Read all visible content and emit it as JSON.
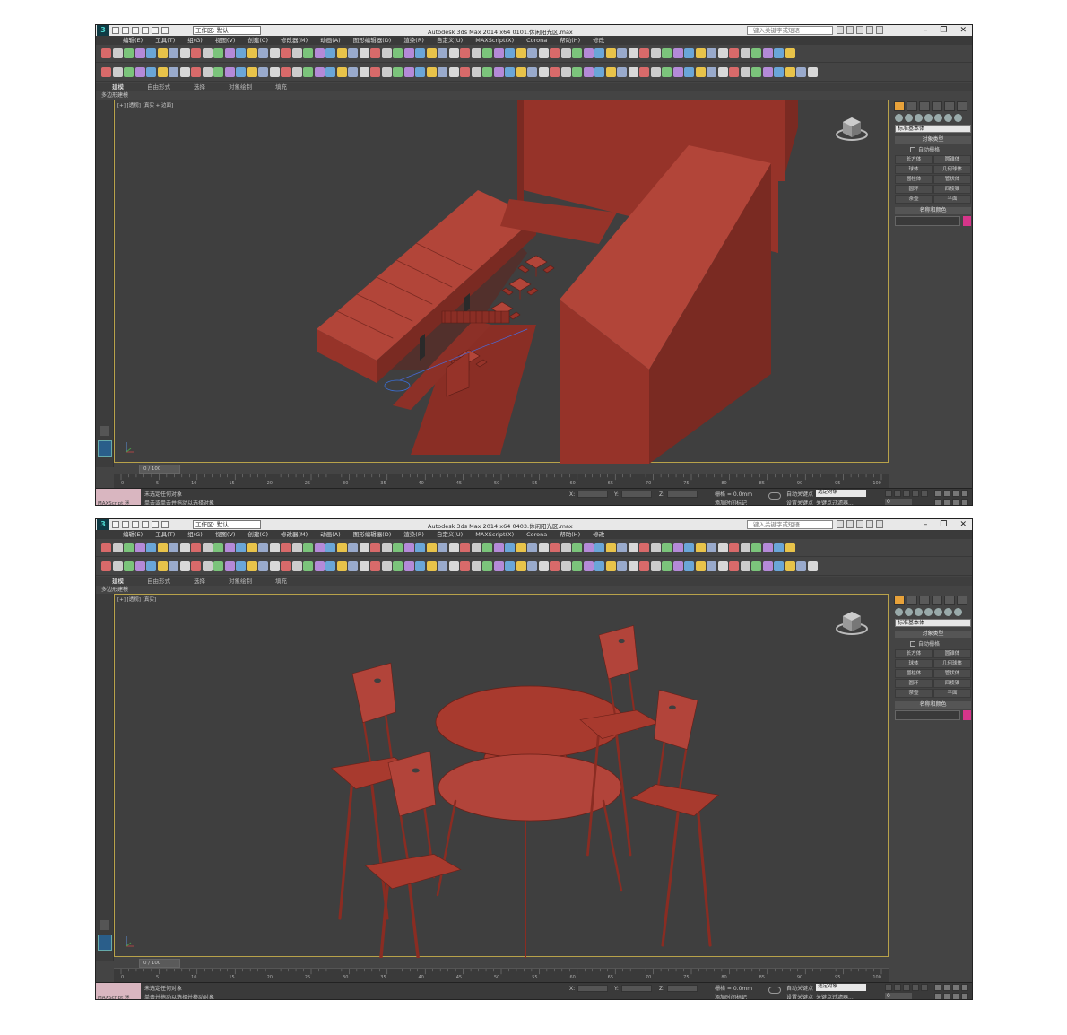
{
  "windows": [
    {
      "title": "Autodesk 3ds Max 2014 x64     0101.休闲阳光区.max",
      "workspace": "工作区: 默认",
      "search_placeholder": "键入关键字或短语",
      "menu": [
        "编辑(E)",
        "工具(T)",
        "组(G)",
        "视图(V)",
        "创建(C)",
        "修改器(M)",
        "动画(A)",
        "图形编辑器(D)",
        "渲染(R)",
        "自定义(U)",
        "MAXScript(X)",
        "Corona",
        "帮助(H)",
        "修改"
      ],
      "ribbon_tabs": [
        "建模",
        "自由形式",
        "选择",
        "对象绘制",
        "填充"
      ],
      "ribbon_sub": "多边形建模",
      "viewport_label": "[+] [透视] [真实 + 边面]",
      "cmd_dropdown": "标准基本体",
      "rollout_object_type": "对象类型",
      "autogrid": "自动栅格",
      "objects": [
        "长方体",
        "圆锥体",
        "球体",
        "几何球体",
        "圆柱体",
        "管状体",
        "圆环",
        "四棱锥",
        "茶壶",
        "平面"
      ],
      "rollout_name_color": "名称和颜色",
      "timeline_slider": "0 / 100",
      "timeline_ticks": [
        "0",
        "5",
        "10",
        "15",
        "20",
        "25",
        "30",
        "35",
        "40",
        "45",
        "50",
        "55",
        "60",
        "65",
        "70",
        "75",
        "80",
        "85",
        "90",
        "95",
        "100"
      ],
      "maxscript": "MAXScript 迷",
      "status_line1": "未选定任何对象",
      "status_line2": "单击或单击并拖动以选择对象",
      "coord_labels": [
        "X:",
        "Y:",
        "Z:"
      ],
      "grid": "栅格 = 0.0mm",
      "add_time_tag": "添加时间标记",
      "auto_key": "自动关键点",
      "set_key": "设置关键点",
      "selection_set": "选定对象",
      "key_filters": "关键点过滤器...",
      "frame": "0"
    },
    {
      "title": "Autodesk 3ds Max 2014 x64     0403.休闲阳光区.max",
      "workspace": "工作区: 默认",
      "search_placeholder": "键入关键字或短语",
      "menu": [
        "编辑(E)",
        "工具(T)",
        "组(G)",
        "视图(V)",
        "创建(C)",
        "修改器(M)",
        "动画(A)",
        "图形编辑器(D)",
        "渲染(R)",
        "自定义(U)",
        "MAXScript(X)",
        "Corona",
        "帮助(H)",
        "修改"
      ],
      "ribbon_tabs": [
        "建模",
        "自由形式",
        "选择",
        "对象绘制",
        "填充"
      ],
      "ribbon_sub": "多边形建模",
      "viewport_label": "[+] [透视] [真实]",
      "cmd_dropdown": "标准基本体",
      "rollout_object_type": "对象类型",
      "autogrid": "自动栅格",
      "objects": [
        "长方体",
        "圆锥体",
        "球体",
        "几何球体",
        "圆柱体",
        "管状体",
        "圆环",
        "四棱锥",
        "茶壶",
        "平面"
      ],
      "rollout_name_color": "名称和颜色",
      "timeline_slider": "0 / 100",
      "timeline_ticks": [
        "0",
        "5",
        "10",
        "15",
        "20",
        "25",
        "30",
        "35",
        "40",
        "45",
        "50",
        "55",
        "60",
        "65",
        "70",
        "75",
        "80",
        "85",
        "90",
        "95",
        "100"
      ],
      "maxscript": "MAXScript 迷",
      "status_line1": "未选定任何对象",
      "status_line2": "单击并拖动以选择并移动对象",
      "coord_labels": [
        "X:",
        "Y:",
        "Z:"
      ],
      "grid": "栅格 = 0.0mm",
      "add_time_tag": "添加时间标记",
      "auto_key": "自动关键点",
      "set_key": "设置关键点",
      "selection_set": "选定对象",
      "key_filters": "关键点过滤器...",
      "frame": "0"
    }
  ],
  "colors": {
    "model_red": "#a83a2e",
    "viewport_bg": "#3f3f3f",
    "accent_pink": "#d6358a"
  }
}
